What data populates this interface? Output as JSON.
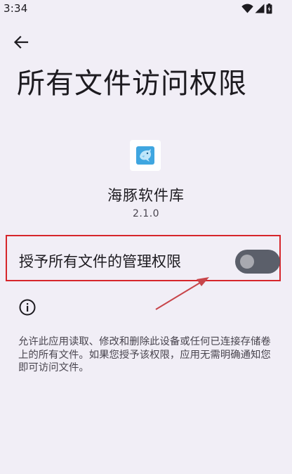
{
  "status_bar": {
    "time": "3:34",
    "icons": [
      "wifi-icon",
      "cellular-signal-icon",
      "battery-icon"
    ]
  },
  "toolbar": {
    "back_icon": "arrow-left-icon"
  },
  "page": {
    "title": "所有文件访问权限"
  },
  "app": {
    "name": "海豚软件库",
    "version": "2.1.0",
    "icon": "dolphin-icon"
  },
  "permission": {
    "label": "授予所有文件的管理权限",
    "enabled": false
  },
  "info": {
    "icon": "info-icon",
    "description": "允许此应用读取、修改和删除此设备或任何已连接存储卷上的所有文件。如果您授予该权限，应用无需明确通知您即可访问文件。"
  },
  "colors": {
    "background": "#F1EEF6",
    "highlight_border": "#D6262B",
    "annotation_arrow": "#C8454A",
    "toggle_track_off": "#5B5F6A",
    "toggle_thumb_off": "#A8A9B0",
    "app_icon_accent": "#3FA6E0"
  }
}
